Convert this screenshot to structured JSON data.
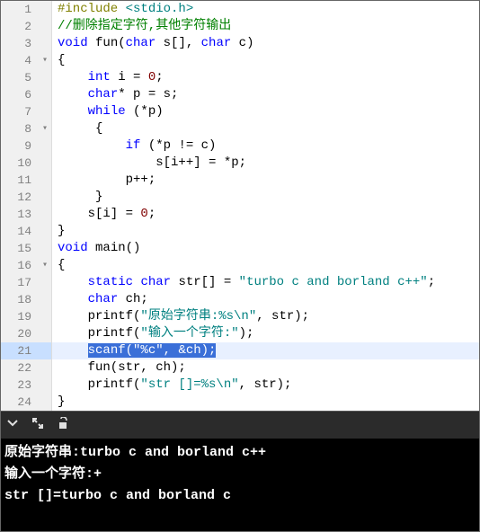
{
  "current_line": 21,
  "code_lines": [
    {
      "n": 1,
      "fold": "",
      "tokens": [
        [
          "pre",
          "#include "
        ],
        [
          "angle",
          "<stdio.h>"
        ]
      ]
    },
    {
      "n": 2,
      "fold": "",
      "tokens": [
        [
          "comment",
          "//删除指定字符,其他字符输出"
        ]
      ]
    },
    {
      "n": 3,
      "fold": "",
      "tokens": [
        [
          "keyword",
          "void"
        ],
        [
          "plain",
          " fun("
        ],
        [
          "keyword",
          "char"
        ],
        [
          "plain",
          " s[], "
        ],
        [
          "keyword",
          "char"
        ],
        [
          "plain",
          " c)"
        ]
      ]
    },
    {
      "n": 4,
      "fold": "▾",
      "tokens": [
        [
          "plain",
          "{"
        ]
      ]
    },
    {
      "n": 5,
      "fold": "",
      "tokens": [
        [
          "plain",
          "    "
        ],
        [
          "keyword",
          "int"
        ],
        [
          "plain",
          " i = "
        ],
        [
          "num",
          "0"
        ],
        [
          "plain",
          ";"
        ]
      ]
    },
    {
      "n": 6,
      "fold": "",
      "tokens": [
        [
          "plain",
          "    "
        ],
        [
          "keyword",
          "char"
        ],
        [
          "plain",
          "* p = s;"
        ]
      ]
    },
    {
      "n": 7,
      "fold": "",
      "tokens": [
        [
          "plain",
          "    "
        ],
        [
          "keyword",
          "while"
        ],
        [
          "plain",
          " (*p)"
        ]
      ]
    },
    {
      "n": 8,
      "fold": "▾",
      "tokens": [
        [
          "plain",
          "     {"
        ]
      ]
    },
    {
      "n": 9,
      "fold": "",
      "tokens": [
        [
          "plain",
          "         "
        ],
        [
          "keyword",
          "if"
        ],
        [
          "plain",
          " (*p != c)"
        ]
      ]
    },
    {
      "n": 10,
      "fold": "",
      "tokens": [
        [
          "plain",
          "             s[i++] = *p;"
        ]
      ]
    },
    {
      "n": 11,
      "fold": "",
      "tokens": [
        [
          "plain",
          "         p++;"
        ]
      ]
    },
    {
      "n": 12,
      "fold": "",
      "tokens": [
        [
          "plain",
          "     }"
        ]
      ]
    },
    {
      "n": 13,
      "fold": "",
      "tokens": [
        [
          "plain",
          "    s[i] = "
        ],
        [
          "num",
          "0"
        ],
        [
          "plain",
          ";"
        ]
      ]
    },
    {
      "n": 14,
      "fold": "",
      "tokens": [
        [
          "plain",
          "}"
        ]
      ]
    },
    {
      "n": 15,
      "fold": "",
      "tokens": [
        [
          "keyword",
          "void"
        ],
        [
          "plain",
          " main()"
        ]
      ]
    },
    {
      "n": 16,
      "fold": "▾",
      "tokens": [
        [
          "plain",
          "{"
        ]
      ]
    },
    {
      "n": 17,
      "fold": "",
      "tokens": [
        [
          "plain",
          "    "
        ],
        [
          "keyword",
          "static"
        ],
        [
          "plain",
          " "
        ],
        [
          "keyword",
          "char"
        ],
        [
          "plain",
          " str[] = "
        ],
        [
          "str",
          "\"turbo c and borland c++\""
        ],
        [
          "plain",
          ";"
        ]
      ]
    },
    {
      "n": 18,
      "fold": "",
      "tokens": [
        [
          "plain",
          "    "
        ],
        [
          "keyword",
          "char"
        ],
        [
          "plain",
          " ch;"
        ]
      ]
    },
    {
      "n": 19,
      "fold": "",
      "tokens": [
        [
          "plain",
          "    printf("
        ],
        [
          "str",
          "\"原始字符串:%s\\n\""
        ],
        [
          "plain",
          ", str);"
        ]
      ]
    },
    {
      "n": 20,
      "fold": "",
      "tokens": [
        [
          "plain",
          "    printf("
        ],
        [
          "str",
          "\"输入一个字符:\""
        ],
        [
          "plain",
          ");"
        ]
      ]
    },
    {
      "n": 21,
      "fold": "",
      "selected": true,
      "tokens": [
        [
          "plain",
          "    "
        ],
        [
          "plain",
          "scanf("
        ],
        [
          "str",
          "\"%c\""
        ],
        [
          "plain",
          ", &ch);"
        ]
      ]
    },
    {
      "n": 22,
      "fold": "",
      "tokens": [
        [
          "plain",
          "    fun(str, ch);"
        ]
      ]
    },
    {
      "n": 23,
      "fold": "",
      "tokens": [
        [
          "plain",
          "    printf("
        ],
        [
          "str",
          "\"str []=%s\\n\""
        ],
        [
          "plain",
          ", str);"
        ]
      ]
    },
    {
      "n": 24,
      "fold": "",
      "tokens": [
        [
          "plain",
          "}"
        ]
      ]
    }
  ],
  "toolbar": {
    "down_icon": "chevron-down-icon",
    "expand_icon": "expand-icon",
    "stop_icon": "stop-icon"
  },
  "console_lines": [
    "原始字符串:turbo c and borland c++",
    "输入一个字符:+",
    "str []=turbo c and borland c"
  ]
}
